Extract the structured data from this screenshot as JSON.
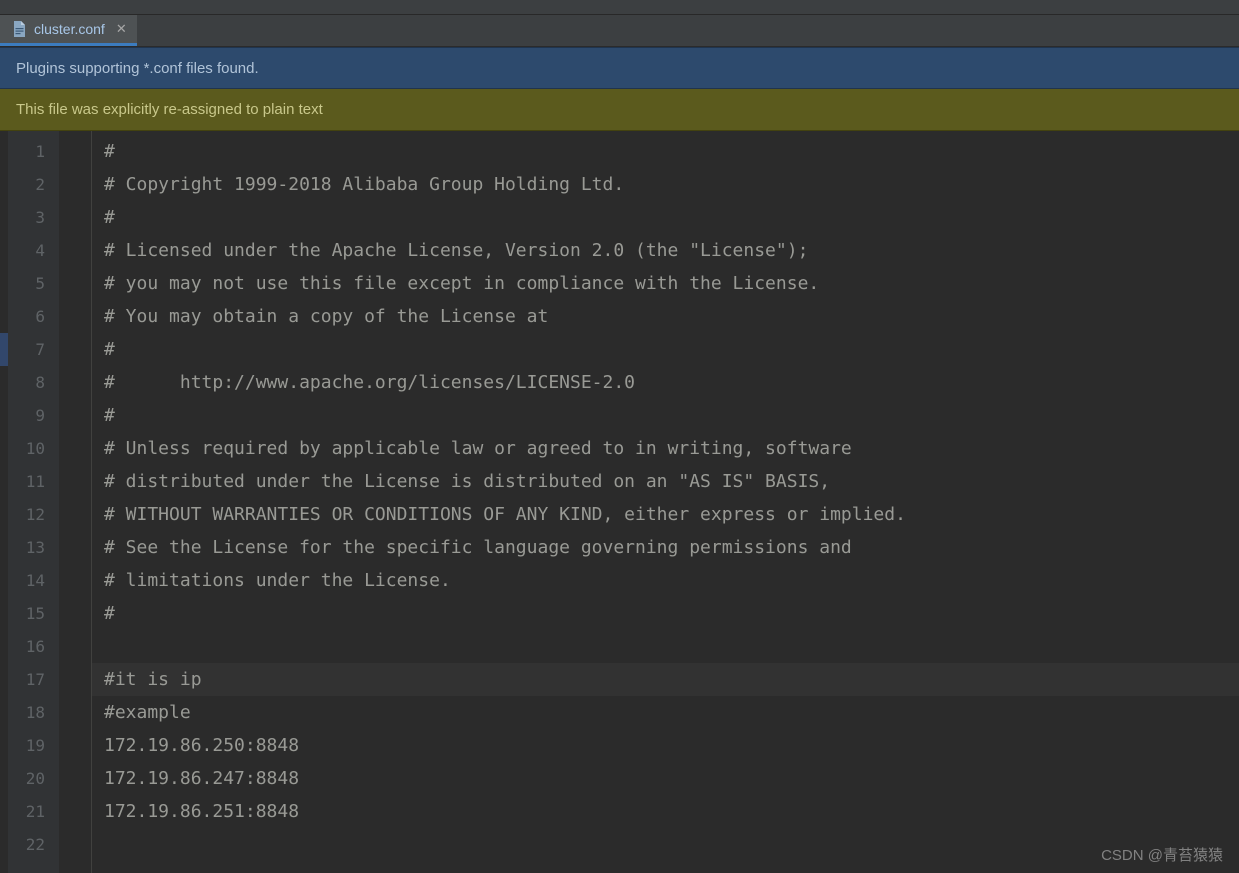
{
  "tab": {
    "filename": "cluster.conf"
  },
  "banners": {
    "plugins": "Plugins supporting *.conf files found.",
    "reassigned": "This file was explicitly re-assigned to plain text"
  },
  "highlighted_line_index": 16,
  "code_lines": [
    "#",
    "# Copyright 1999-2018 Alibaba Group Holding Ltd.",
    "#",
    "# Licensed under the Apache License, Version 2.0 (the \"License\");",
    "# you may not use this file except in compliance with the License.",
    "# You may obtain a copy of the License at",
    "#",
    "#      http://www.apache.org/licenses/LICENSE-2.0",
    "#",
    "# Unless required by applicable law or agreed to in writing, software",
    "# distributed under the License is distributed on an \"AS IS\" BASIS,",
    "# WITHOUT WARRANTIES OR CONDITIONS OF ANY KIND, either express or implied.",
    "# See the License for the specific language governing permissions and",
    "# limitations under the License.",
    "#",
    "",
    "#it is ip",
    "#example",
    "172.19.86.250:8848",
    "172.19.86.247:8848",
    "172.19.86.251:8848",
    ""
  ],
  "watermark": "CSDN @青苔猿猿"
}
